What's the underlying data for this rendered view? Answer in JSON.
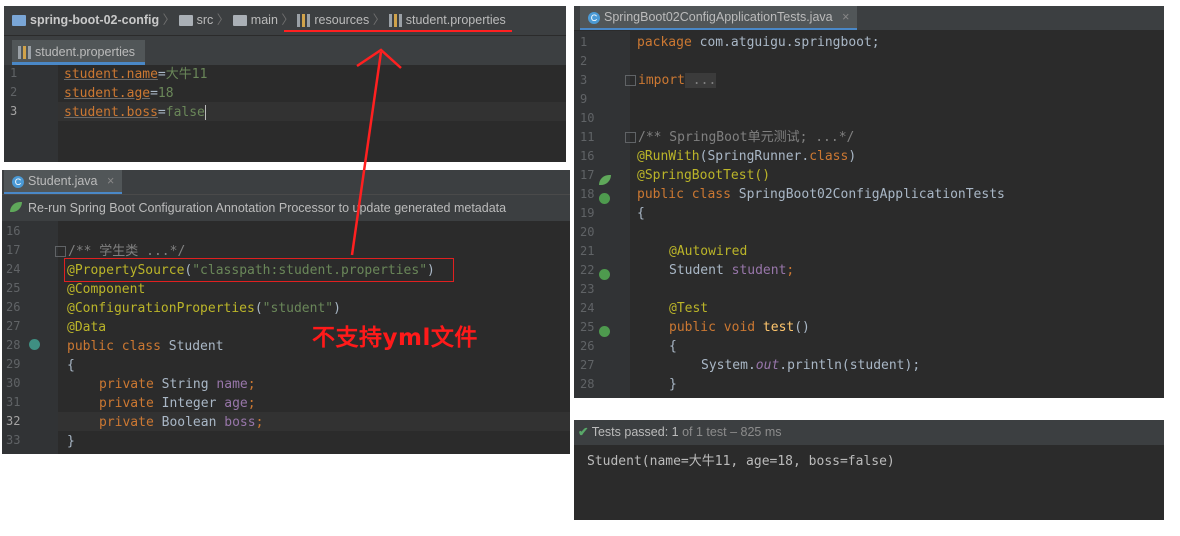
{
  "breadcrumb": {
    "project": "spring-boot-02-config",
    "items": [
      "src",
      "main",
      "resources",
      "student.properties"
    ]
  },
  "properties_editor": {
    "tab": "student.properties",
    "lines": [
      {
        "num": "1",
        "key": "student.name",
        "value": "大牛11"
      },
      {
        "num": "2",
        "key": "student.age",
        "value": "18"
      },
      {
        "num": "3",
        "key": "student.boss",
        "value": "false"
      }
    ]
  },
  "student_editor": {
    "tab": "Student.java",
    "tab_close": "×",
    "notification": "Re-run Spring Boot Configuration Annotation Processor to update generated metadata",
    "line_numbers": [
      "16",
      "17",
      "24",
      "25",
      "26",
      "27",
      "28",
      "29",
      "30",
      "31",
      "32",
      "33"
    ],
    "code": {
      "doc_comment": "/** 学生类 ...*/",
      "property_source_ann": "@PropertySource",
      "property_source_open": "(",
      "property_source_arg": "\"classpath:student.properties\"",
      "property_source_close": ")",
      "component": "@Component",
      "config_props_ann": "@ConfigurationProperties",
      "config_props_open": "(",
      "config_props_arg": "\"student\"",
      "config_props_close": ")",
      "data": "@Data",
      "class_kw": "public class",
      "class_name": " Student",
      "open_brace": "{",
      "close_brace": "}",
      "private_kw": "private",
      "fields": [
        {
          "type": " String ",
          "name": "name"
        },
        {
          "type": " Integer ",
          "name": "age"
        },
        {
          "type": " Boolean ",
          "name": "boss"
        }
      ],
      "semicolon": ";"
    }
  },
  "annotation_note": "不支持yml文件",
  "test_editor": {
    "tab": "SpringBoot02ConfigApplicationTests.java",
    "tab_close": "×",
    "line_numbers": [
      "1",
      "2",
      "3",
      "9",
      "10",
      "11",
      "16",
      "17",
      "18",
      "19",
      "20",
      "21",
      "22",
      "23",
      "24",
      "25",
      "26",
      "27",
      "28"
    ],
    "code": {
      "package_kw": "package",
      "package_name": " com.atguigu.springboot;",
      "import_kw": "import",
      "import_rest": " ...",
      "doc_comment": "/** SpringBoot单元测试; ...*/",
      "runwith_ann": "@RunWith",
      "runwith_arg_open": "(SpringRunner.",
      "runwith_class_kw": "class",
      "runwith_arg_close": ")",
      "springboottest": "@SpringBootTest()",
      "class_kw": "public class",
      "class_name": " SpringBoot02ConfigApplicationTests",
      "open_brace": "{",
      "autowired": "@Autowired",
      "field_type": "Student ",
      "field_name": "student",
      "semicolon": ";",
      "test_ann": "@Test",
      "method_kw": "public void",
      "method_name": " test",
      "method_parens": "()",
      "system": "System.",
      "out": "out",
      "println": ".println(student);",
      "close_brace": "}"
    }
  },
  "test_results": {
    "status_label": "Tests passed:",
    "count": "1",
    "of_label": "of 1 test",
    "duration": "– 825 ms",
    "output": "Student(name=大牛11, age=18, boss=false)"
  },
  "colors": {
    "editor_bg": "#2b2b2b",
    "keyword": "#cc7832",
    "annotation": "#bbb529",
    "string": "#6a8759",
    "field": "#9876aa",
    "arrow": "#ff2020",
    "note": "#ff1a1a"
  }
}
